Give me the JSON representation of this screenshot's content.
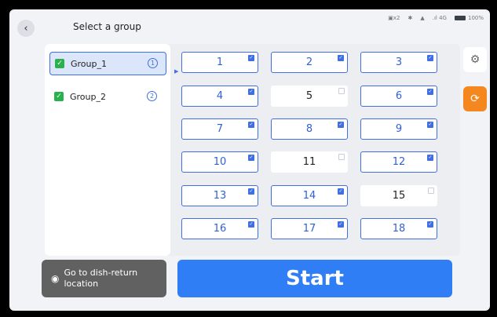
{
  "header": {
    "title": "Select a group",
    "status": {
      "robot": "x2",
      "bluetooth": "✱",
      "wifi": "▲",
      "signal": "4G",
      "battery": "100%"
    }
  },
  "groups": [
    {
      "label": "Group_1",
      "index": "1",
      "selected": true,
      "checked": true
    },
    {
      "label": "Group_2",
      "index": "2",
      "selected": false,
      "checked": true
    }
  ],
  "tables": [
    {
      "label": "1",
      "selected": true
    },
    {
      "label": "2",
      "selected": true
    },
    {
      "label": "3",
      "selected": true
    },
    {
      "label": "4",
      "selected": true
    },
    {
      "label": "5",
      "selected": false
    },
    {
      "label": "6",
      "selected": true
    },
    {
      "label": "7",
      "selected": true
    },
    {
      "label": "8",
      "selected": true
    },
    {
      "label": "9",
      "selected": true
    },
    {
      "label": "10",
      "selected": true
    },
    {
      "label": "11",
      "selected": false
    },
    {
      "label": "12",
      "selected": true
    },
    {
      "label": "13",
      "selected": true
    },
    {
      "label": "14",
      "selected": true
    },
    {
      "label": "15",
      "selected": false
    },
    {
      "label": "16",
      "selected": true
    },
    {
      "label": "17",
      "selected": true
    },
    {
      "label": "18",
      "selected": true
    }
  ],
  "actions": {
    "dish_return_line1": "Go to dish-return",
    "dish_return_line2": "location",
    "start": "Start"
  },
  "colors": {
    "accent": "#2f7ef5",
    "check_green": "#28b14c",
    "orange": "#f5871f",
    "dark_button": "#616161"
  }
}
